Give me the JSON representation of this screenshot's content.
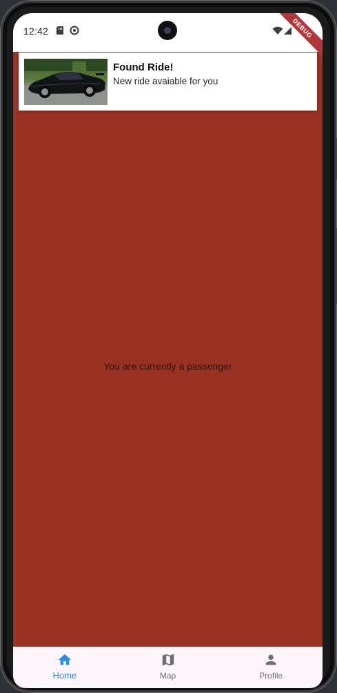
{
  "status_bar": {
    "time": "12:42",
    "icons_left": [
      "sd-card-icon",
      "sync-icon"
    ],
    "icons_right": [
      "wifi-icon",
      "cell-signal-icon"
    ],
    "debug_banner": "DEBUG"
  },
  "notification": {
    "title": "Found Ride!",
    "body": "New ride avaiable for you",
    "image": "car-thumbnail"
  },
  "main": {
    "background_color": "#993222",
    "message": "You are currently a passenger"
  },
  "bottom_nav": {
    "items": [
      {
        "label": "Home",
        "icon": "home-icon",
        "active": true
      },
      {
        "label": "Map",
        "icon": "map-icon",
        "active": false
      },
      {
        "label": "Profile",
        "icon": "person-icon",
        "active": false
      }
    ],
    "active_color": "#2d8fd9",
    "inactive_color": "#6f6f73"
  }
}
